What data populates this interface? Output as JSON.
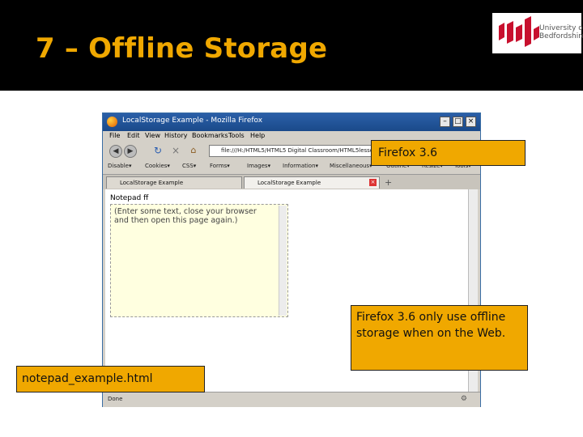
{
  "slide": {
    "title": "7 – Offline Storage",
    "logo_text_line1": "University of",
    "logo_text_line2": "Bedfordshire"
  },
  "browser": {
    "window_title": "LocalStorage Example - Mozilla Firefox",
    "menu": [
      "File",
      "Edit",
      "View",
      "History",
      "Bookmarks",
      "Tools",
      "Help"
    ],
    "url": "file:///H:/HTML5/HTML5 Digital Classroom/HTML5lessons/",
    "bookmarks": [
      "Disable▾",
      "Cookies▾",
      "CSS▾",
      "Forms▾",
      "Images▾",
      "Information▾",
      "Miscellaneous▾",
      "Outline▾",
      "Resize▾",
      "Tools▾"
    ],
    "tabs": [
      "LocalStorage Example",
      "LocalStorage Example"
    ],
    "content_heading": "Notepad ff",
    "notepad_text": "(Enter some text, close your browser and then open this page again.)",
    "status": "Done"
  },
  "callouts": {
    "version": "Firefox 3.6",
    "note": "Firefox 3.6 only use offline storage when on the Web.",
    "filename": "notepad_example.html"
  },
  "colors": {
    "title": "#f0a800",
    "callout_bg": "#f0a800",
    "header_bg": "#000000"
  }
}
